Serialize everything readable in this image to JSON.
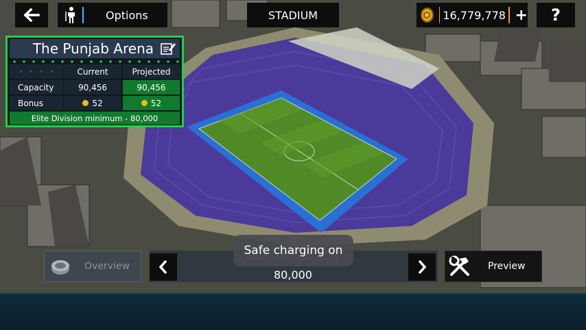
{
  "topbar": {
    "options_label": "Options",
    "screen_title": "STADIUM",
    "coins": "16,779,778",
    "help_label": "?"
  },
  "stadium": {
    "name": "The Punjab Arena",
    "col_current": "Current",
    "col_projected": "Projected",
    "rows": [
      {
        "label": "Capacity",
        "current": "90,456",
        "projected": "90,456"
      },
      {
        "label": "Bonus",
        "current": "52",
        "projected": "52"
      }
    ],
    "elite_note": "Elite Division minimum - 80,000"
  },
  "controls": {
    "overview_label": "Overview",
    "auto_build_label": "Auto Build Capacity",
    "auto_build_value": "80,000",
    "preview_label": "Preview"
  },
  "toast": {
    "message": "Safe charging on"
  },
  "colors": {
    "panel_border": "#22d14a",
    "projected_cell": "#127a2e",
    "stands": "#4b3a9a",
    "pitch": "#4f8a26",
    "pitch_ring": "#2a6fd4"
  },
  "icons": [
    "back-arrow-icon",
    "player-figure-icon",
    "coin-icon",
    "plus-icon",
    "help-icon",
    "edit-icon",
    "stadium-overview-icon",
    "chevron-left-icon",
    "chevron-right-icon",
    "hammer-wrench-icon"
  ]
}
